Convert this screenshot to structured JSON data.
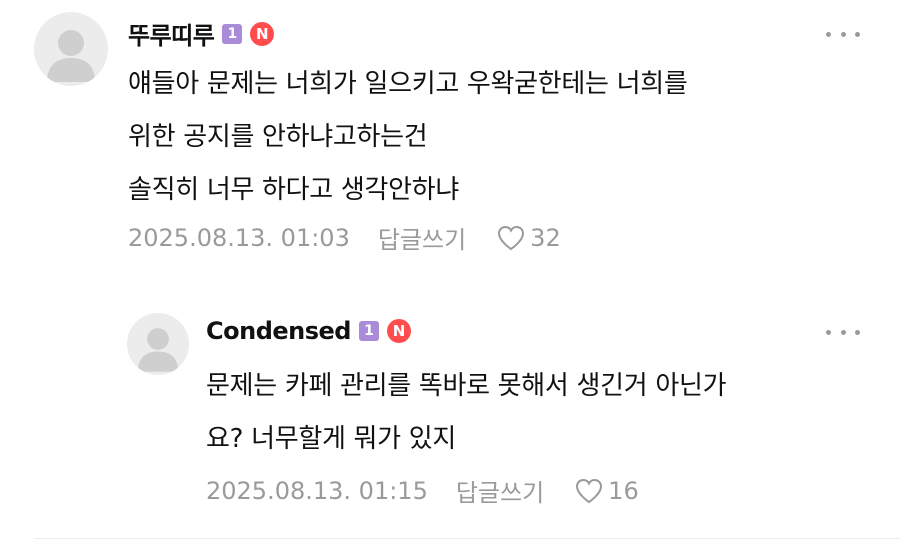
{
  "comments": [
    {
      "nickname": "뚜루띠루",
      "level_badge": "1",
      "new_badge": "N",
      "lines": [
        "얘들아 문제는 너희가 일으키고 우왁굳한테는 너희를",
        "위한 공지를 안하냐고하는건",
        "솔직히 너무 하다고 생각안하냐"
      ],
      "date": "2025.08.13. 01:03",
      "reply_label": "답글쓰기",
      "likes": "32"
    },
    {
      "nickname": "Condensed",
      "level_badge": "1",
      "new_badge": "N",
      "lines": [
        "문제는 카페 관리를 똑바로 못해서 생긴거 아닌가",
        "요? 너무할게 뭐가 있지"
      ],
      "date": "2025.08.13. 01:15",
      "reply_label": "답글쓰기",
      "likes": "16"
    }
  ],
  "colors": {
    "text": "#111111",
    "meta": "#9a9a9a",
    "level_badge": "#a98bd9",
    "new_badge": "#ff4d4d",
    "avatar_bg": "#ececec"
  },
  "icons": {
    "avatar": "default-profile-icon",
    "more": "more-dots-icon",
    "like": "heart-outline-icon"
  }
}
